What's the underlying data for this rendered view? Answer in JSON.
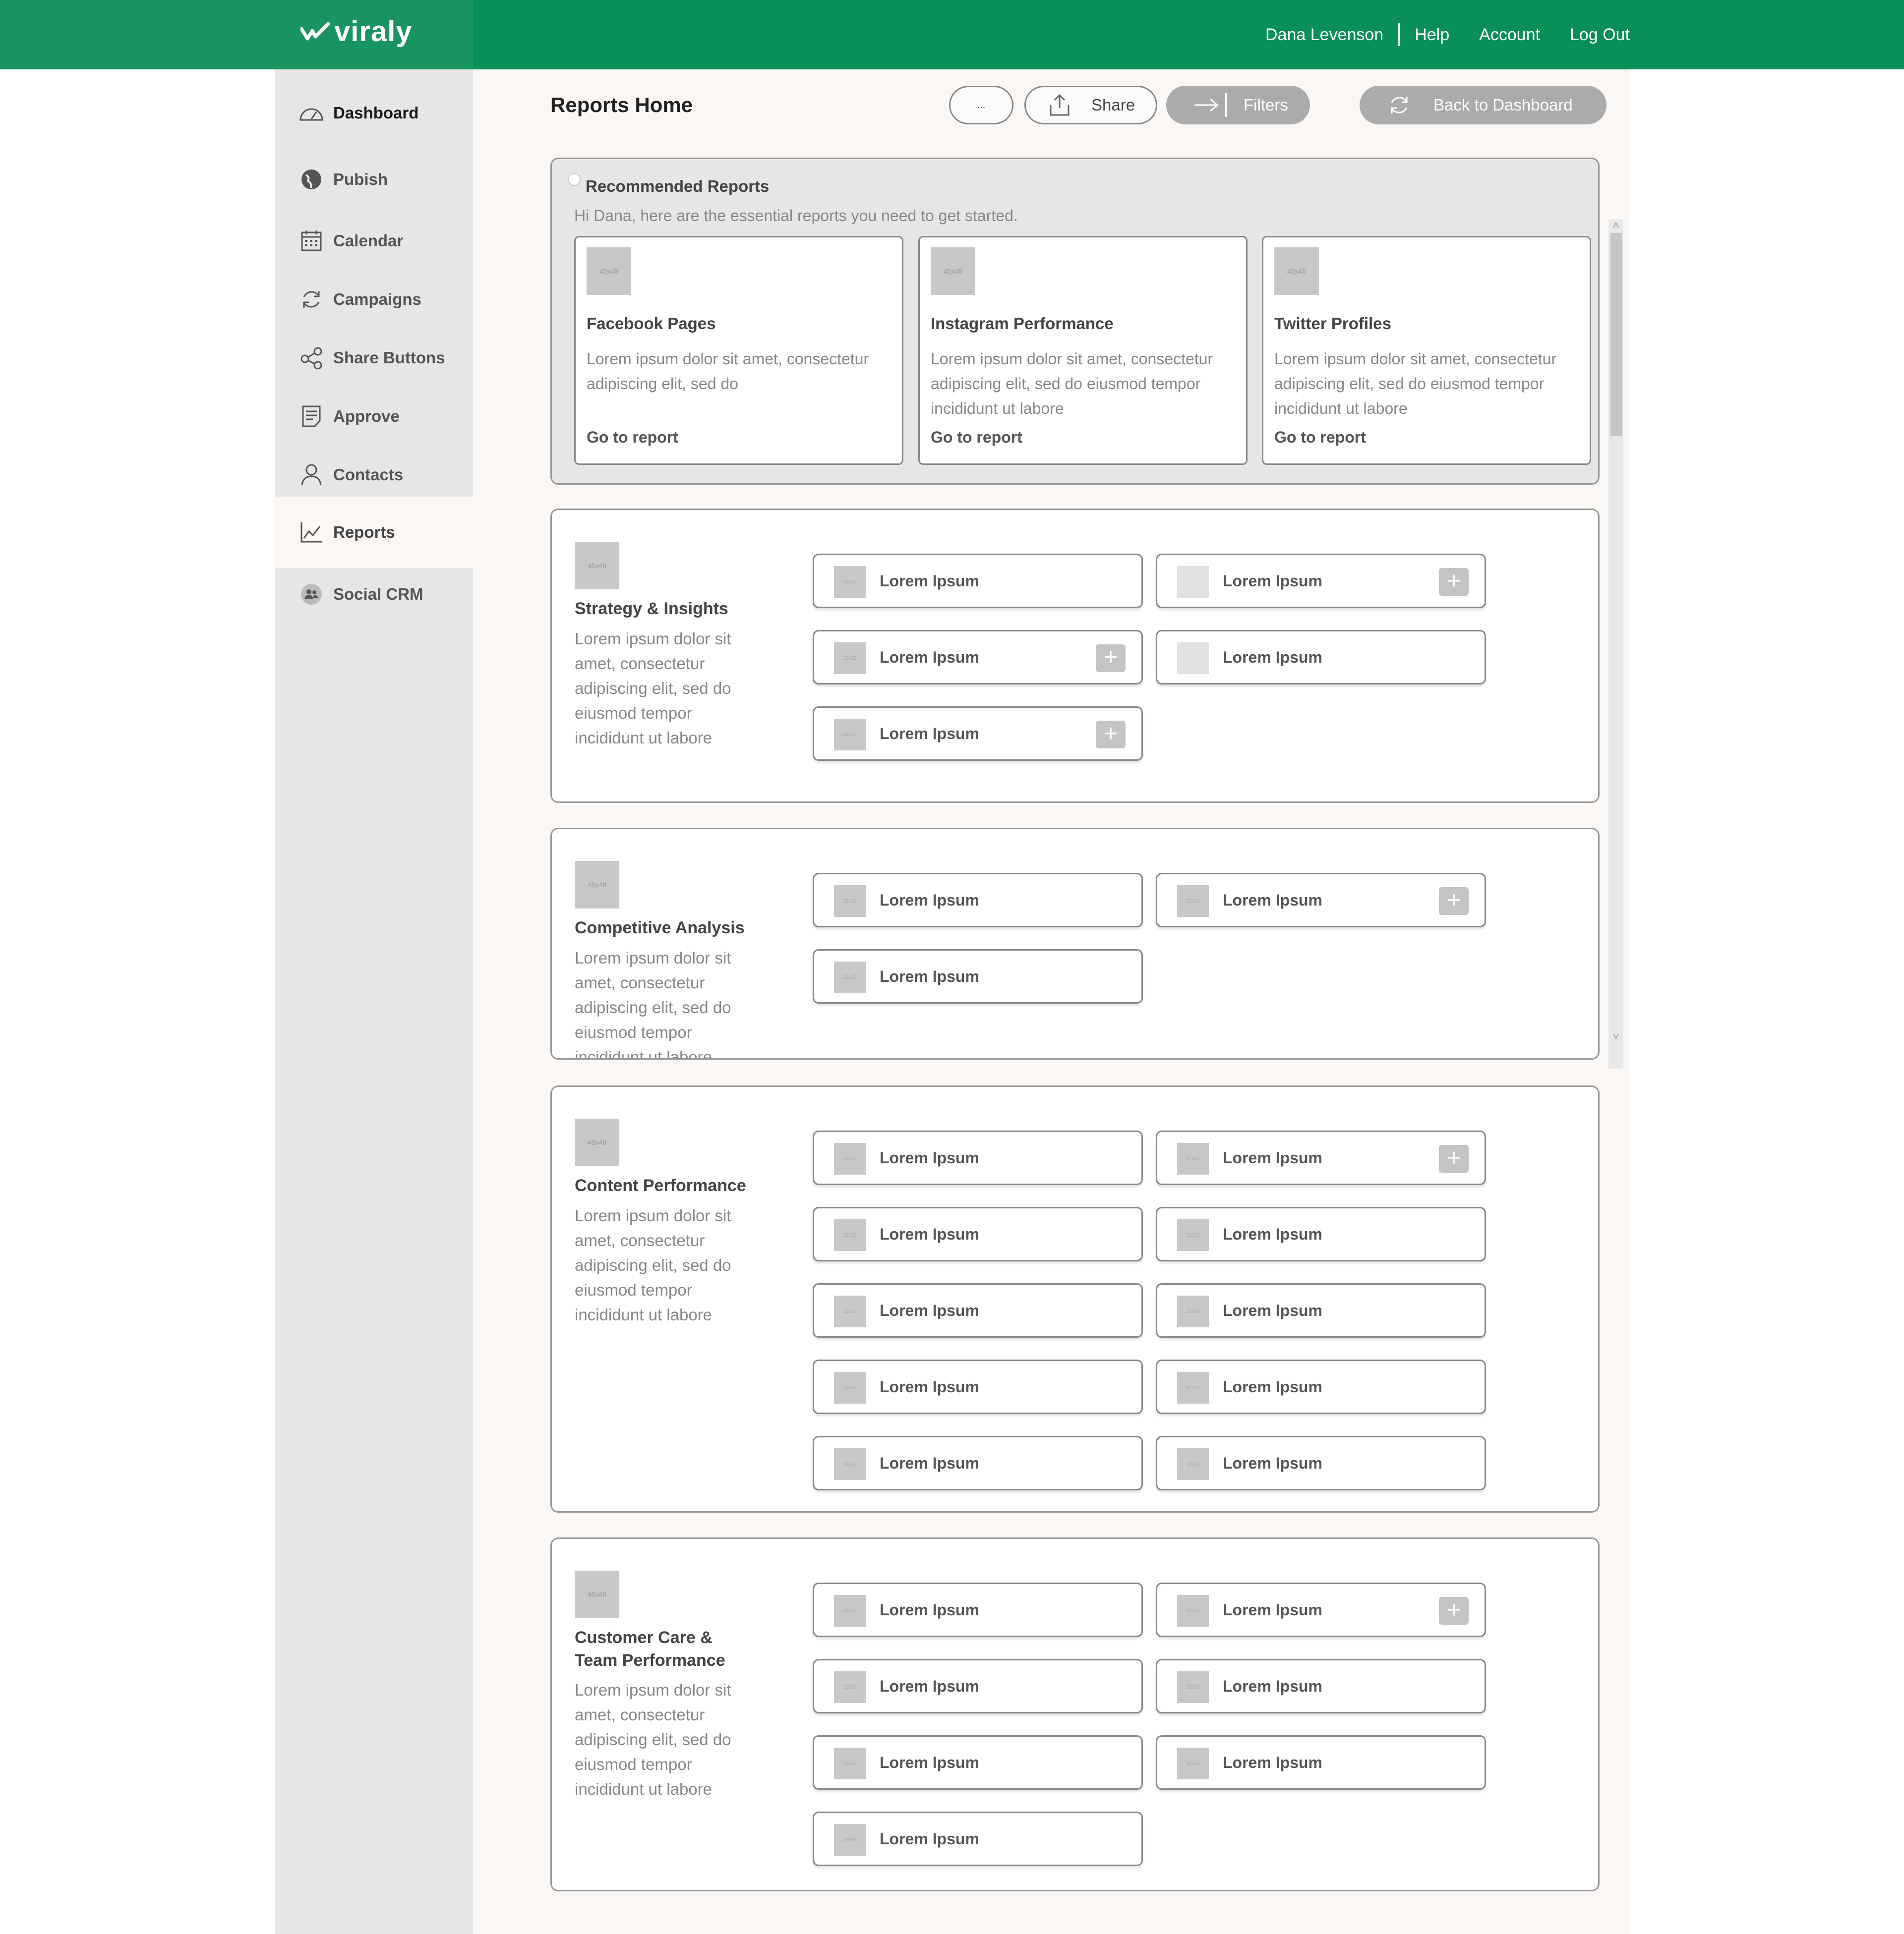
{
  "header": {
    "logo_text": "viraly",
    "nav": [
      {
        "label": "Dana Levenson"
      },
      {
        "label": "Help"
      },
      {
        "label": "Account"
      },
      {
        "label": "Log Out"
      }
    ]
  },
  "sidebar": {
    "items": [
      {
        "label": "Dashboard",
        "icon": "gauge-icon"
      },
      {
        "label": "Pubish",
        "icon": "globe-icon"
      },
      {
        "label": "Calendar",
        "icon": "calendar-icon"
      },
      {
        "label": "Campaigns",
        "icon": "refresh-icon"
      },
      {
        "label": "Share Buttons",
        "icon": "share-icon"
      },
      {
        "label": "Approve",
        "icon": "document-icon"
      },
      {
        "label": "Contacts",
        "icon": "user-icon"
      },
      {
        "label": "Reports",
        "icon": "chart-icon"
      },
      {
        "label": "Social CRM",
        "icon": "people-icon"
      }
    ],
    "active": "Reports"
  },
  "main": {
    "title": "Reports Home",
    "toolbar": {
      "more_label": "...",
      "share_label": "Share",
      "filters_label": "Filters",
      "back_label": "Back to Dashboard"
    },
    "recommended": {
      "title": "Recommended Reports",
      "subtitle": "Hi Dana, here are the essential reports you need to get started.",
      "cards": [
        {
          "thumb": "45x48",
          "title": "Facebook Pages",
          "desc": "Lorem ipsum dolor sit amet, consectetur adipiscing elit, sed do",
          "link": "Go to report"
        },
        {
          "thumb": "45x48",
          "title": "Instagram Performance",
          "desc": "Lorem ipsum dolor sit amet, consectetur adipiscing elit, sed do eiusmod tempor incididunt ut labore",
          "link": "Go to report"
        },
        {
          "thumb": "45x48",
          "title": "Twitter Profiles",
          "desc": "Lorem ipsum dolor sit amet, consectetur adipiscing elit, sed do eiusmod tempor incididunt ut labore",
          "link": "Go to report"
        }
      ]
    },
    "sections": [
      {
        "thumb": "45x48",
        "title": "Strategy & Insights",
        "desc": "Lorem ipsum dolor sit amet, consectetur adipiscing elit, sed do eiusmod tempor incididunt ut labore",
        "tiles": [
          {
            "label": "Lorem Ipsum",
            "thumb": "32x32",
            "plus": false
          },
          {
            "label": "Lorem Ipsum",
            "thumb": "",
            "plus": true
          },
          {
            "label": "Lorem Ipsum",
            "thumb": "32x32",
            "plus": true
          },
          {
            "label": "Lorem Ipsum",
            "thumb": "",
            "plus": false
          },
          {
            "label": "Lorem Ipsum",
            "thumb": "32x32",
            "plus": true
          }
        ]
      },
      {
        "thumb": "45x48",
        "title": "Competitive Analysis",
        "desc": "Lorem ipsum dolor sit amet, consectetur adipiscing elit, sed do eiusmod tempor incididunt ut labore",
        "tiles": [
          {
            "label": "Lorem Ipsum",
            "thumb": "32x32",
            "plus": false
          },
          {
            "label": "Lorem Ipsum",
            "thumb": "32x32",
            "plus": true
          },
          {
            "label": "Lorem Ipsum",
            "thumb": "32x32",
            "plus": false
          }
        ]
      },
      {
        "thumb": "45x48",
        "title": "Content Performance",
        "desc": "Lorem ipsum dolor sit amet, consectetur adipiscing elit, sed do eiusmod tempor incididunt ut labore",
        "tiles": [
          {
            "label": "Lorem Ipsum",
            "thumb": "32x32",
            "plus": false
          },
          {
            "label": "Lorem Ipsum",
            "thumb": "32x32",
            "plus": true
          },
          {
            "label": "Lorem Ipsum",
            "thumb": "32x32",
            "plus": false
          },
          {
            "label": "Lorem Ipsum",
            "thumb": "32x32",
            "plus": false
          },
          {
            "label": "Lorem Ipsum",
            "thumb": "32x32",
            "plus": false
          },
          {
            "label": "Lorem Ipsum",
            "thumb": "32x32",
            "plus": false
          },
          {
            "label": "Lorem Ipsum",
            "thumb": "32x32",
            "plus": false
          },
          {
            "label": "Lorem Ipsum",
            "thumb": "32x32",
            "plus": false
          },
          {
            "label": "Lorem Ipsum",
            "thumb": "32x32",
            "plus": false
          },
          {
            "label": "Lorem Ipsum",
            "thumb": "32x32",
            "plus": false
          }
        ]
      },
      {
        "thumb": "45x48",
        "title": "Customer Care & Team Performance",
        "desc": "Lorem ipsum dolor sit amet, consectetur adipiscing elit, sed do eiusmod tempor incididunt ut labore",
        "tiles": [
          {
            "label": "Lorem Ipsum",
            "thumb": "32x32",
            "plus": false
          },
          {
            "label": "Lorem Ipsum",
            "thumb": "32x32",
            "plus": true
          },
          {
            "label": "Lorem Ipsum",
            "thumb": "32x32",
            "plus": false
          },
          {
            "label": "Lorem Ipsum",
            "thumb": "32x32",
            "plus": false
          },
          {
            "label": "Lorem Ipsum",
            "thumb": "32x32",
            "plus": false
          },
          {
            "label": "Lorem Ipsum",
            "thumb": "32x32",
            "plus": false
          },
          {
            "label": "Lorem Ipsum",
            "thumb": "32x32",
            "plus": false
          }
        ]
      }
    ]
  },
  "colors": {
    "brand_green": "#0a8f57",
    "sidebar_bg": "#e6e6e6",
    "main_bg": "#faf7f5"
  }
}
